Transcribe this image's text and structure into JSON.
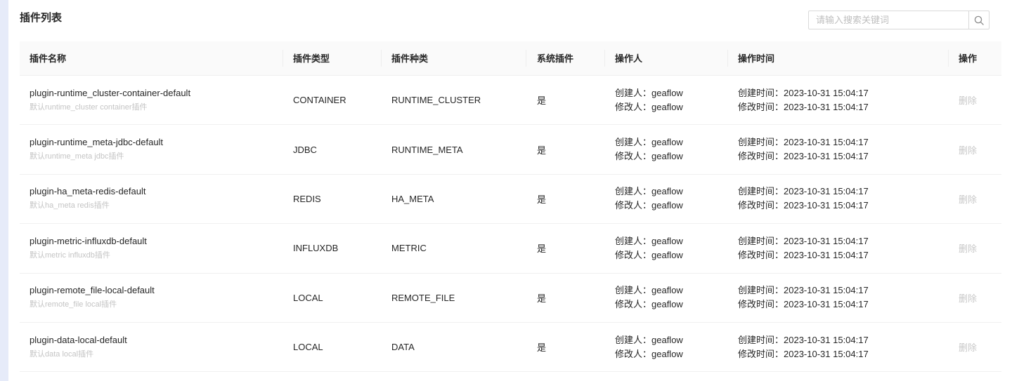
{
  "page": {
    "title": "插件列表"
  },
  "search": {
    "placeholder": "请输入搜索关键词",
    "value": "",
    "icon": "search-icon"
  },
  "table": {
    "columns": [
      "插件名称",
      "插件类型",
      "插件种类",
      "系统插件",
      "操作人",
      "操作时间",
      "操作"
    ],
    "rows": [
      {
        "name": "plugin-runtime_cluster-container-default",
        "desc": "默认runtime_cluster container插件",
        "type": "CONTAINER",
        "category": "RUNTIME_CLUSTER",
        "system": "是",
        "creator": "创建人：geaflow",
        "modifier": "修改人：geaflow",
        "create_time": "创建时间：2023-10-31 15:04:17",
        "modify_time": "修改时间：2023-10-31 15:04:17",
        "action": "删除"
      },
      {
        "name": "plugin-runtime_meta-jdbc-default",
        "desc": "默认runtime_meta jdbc插件",
        "type": "JDBC",
        "category": "RUNTIME_META",
        "system": "是",
        "creator": "创建人：geaflow",
        "modifier": "修改人：geaflow",
        "create_time": "创建时间：2023-10-31 15:04:17",
        "modify_time": "修改时间：2023-10-31 15:04:17",
        "action": "删除"
      },
      {
        "name": "plugin-ha_meta-redis-default",
        "desc": "默认ha_meta redis插件",
        "type": "REDIS",
        "category": "HA_META",
        "system": "是",
        "creator": "创建人：geaflow",
        "modifier": "修改人：geaflow",
        "create_time": "创建时间：2023-10-31 15:04:17",
        "modify_time": "修改时间：2023-10-31 15:04:17",
        "action": "删除"
      },
      {
        "name": "plugin-metric-influxdb-default",
        "desc": "默认metric influxdb插件",
        "type": "INFLUXDB",
        "category": "METRIC",
        "system": "是",
        "creator": "创建人：geaflow",
        "modifier": "修改人：geaflow",
        "create_time": "创建时间：2023-10-31 15:04:17",
        "modify_time": "修改时间：2023-10-31 15:04:17",
        "action": "删除"
      },
      {
        "name": "plugin-remote_file-local-default",
        "desc": "默认remote_file local插件",
        "type": "LOCAL",
        "category": "REMOTE_FILE",
        "system": "是",
        "creator": "创建人：geaflow",
        "modifier": "修改人：geaflow",
        "create_time": "创建时间：2023-10-31 15:04:17",
        "modify_time": "修改时间：2023-10-31 15:04:17",
        "action": "删除"
      },
      {
        "name": "plugin-data-local-default",
        "desc": "默认data local插件",
        "type": "LOCAL",
        "category": "DATA",
        "system": "是",
        "creator": "创建人：geaflow",
        "modifier": "修改人：geaflow",
        "create_time": "创建时间：2023-10-31 15:04:17",
        "modify_time": "修改时间：2023-10-31 15:04:17",
        "action": "删除"
      }
    ]
  }
}
